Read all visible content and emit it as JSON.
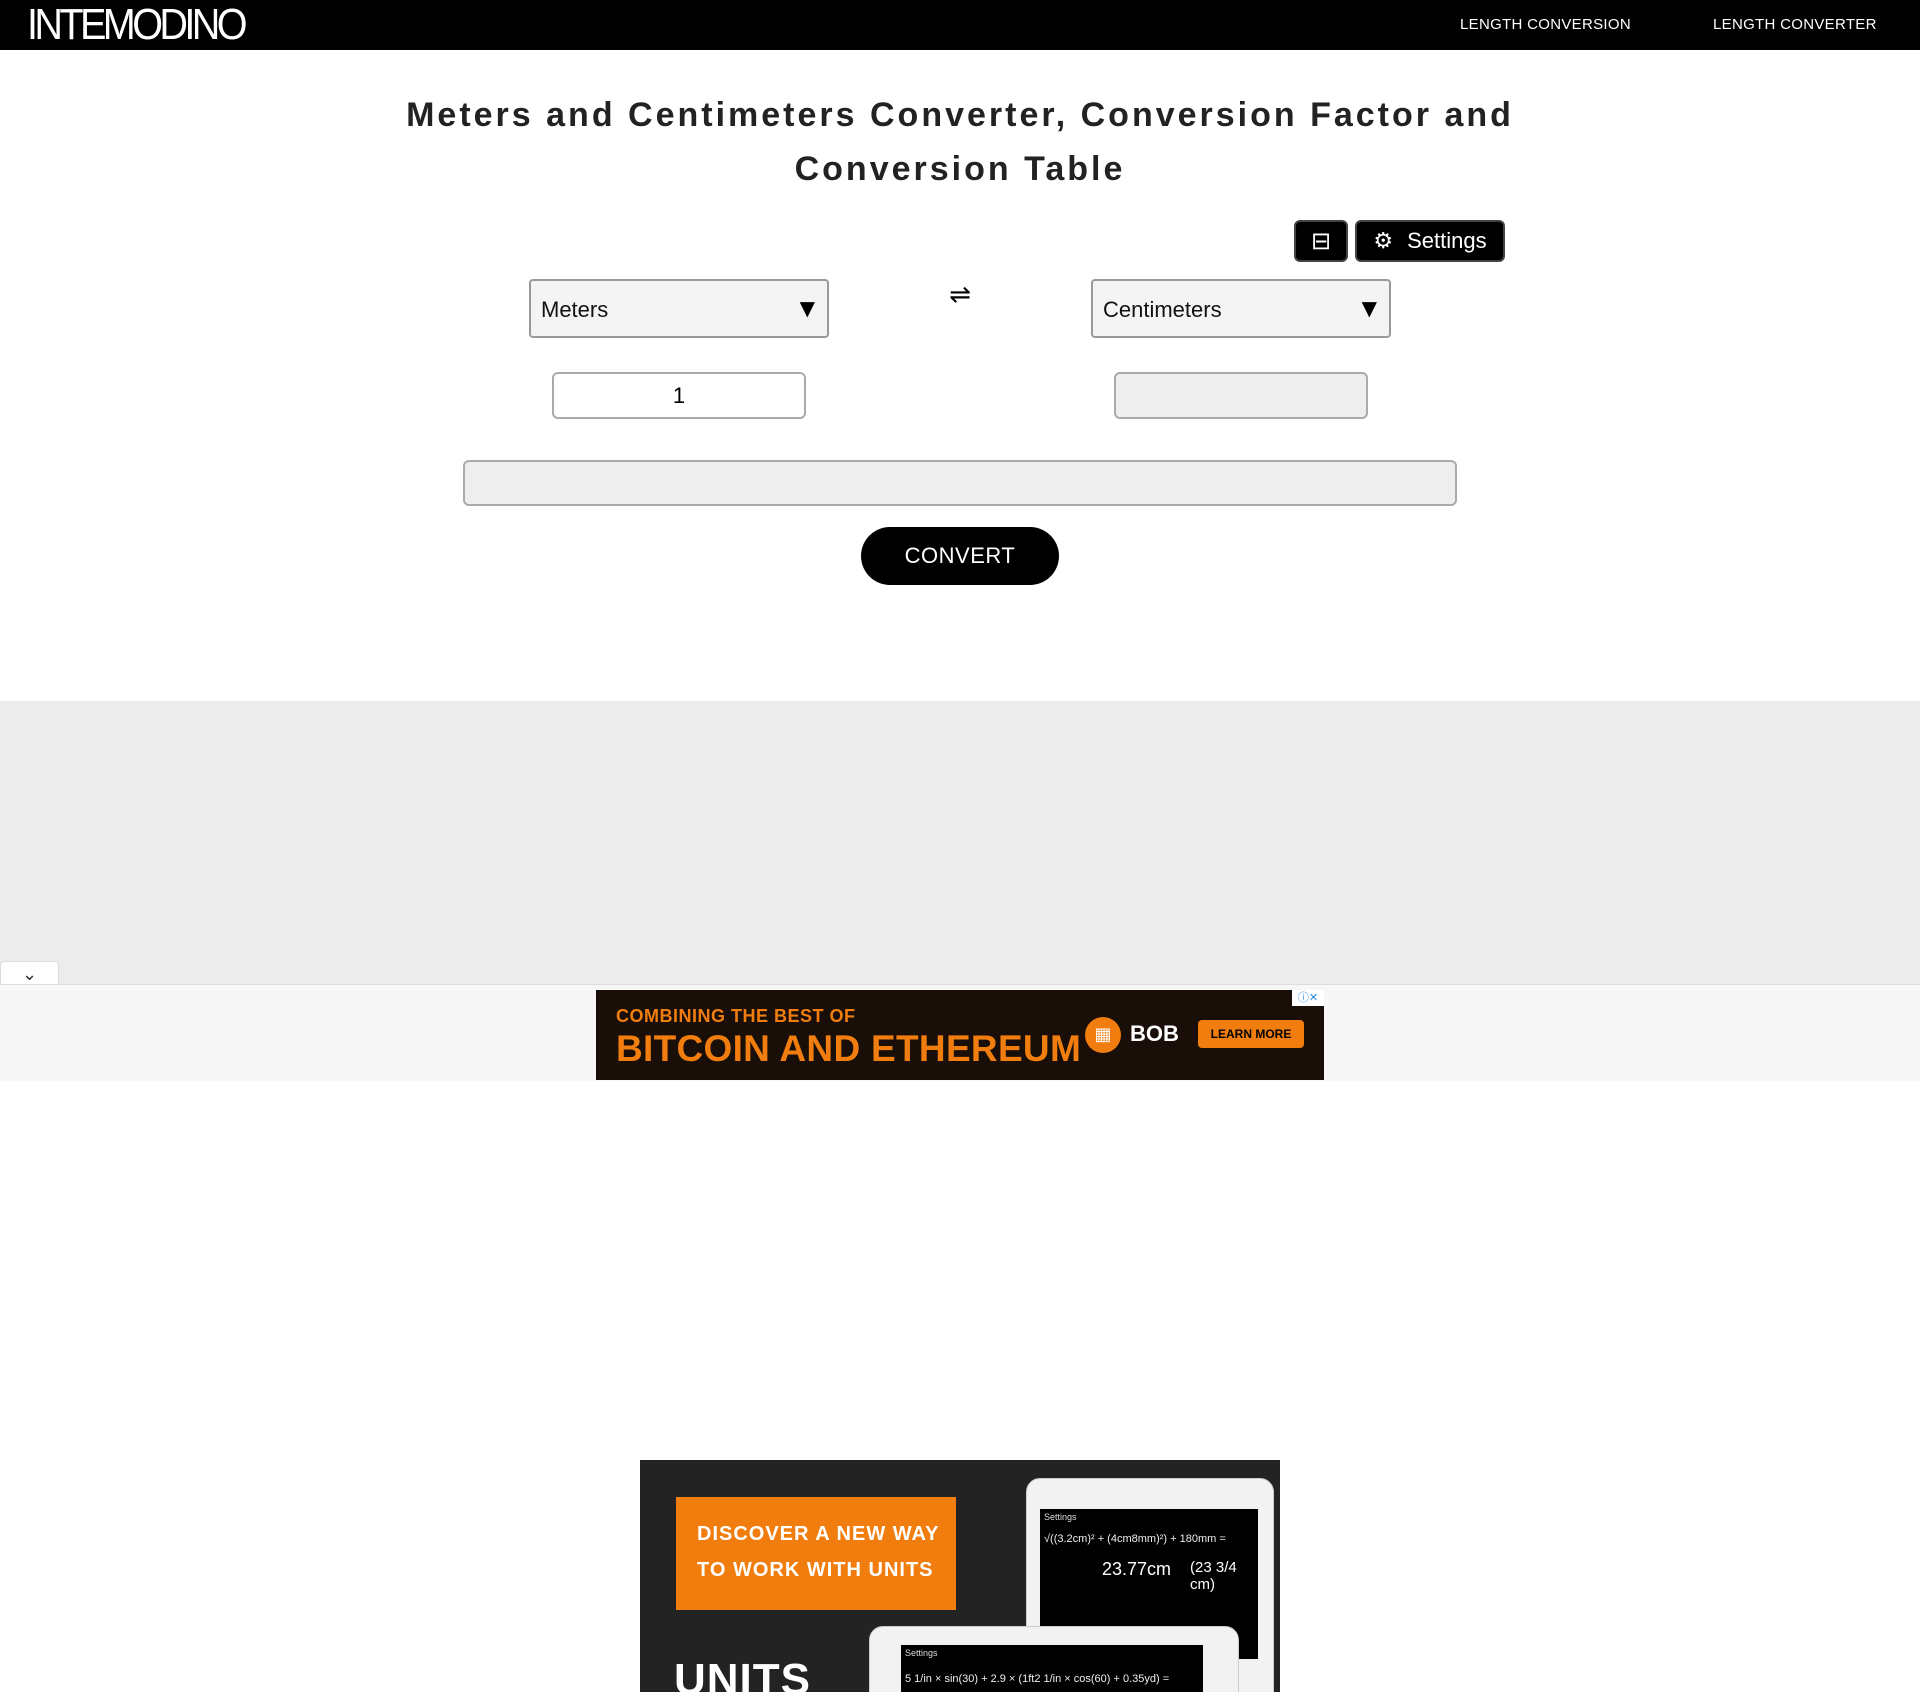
{
  "header": {
    "logo": "INTEMODINO",
    "nav": [
      "LENGTH CONVERSION",
      "LENGTH CONVERTER"
    ]
  },
  "page": {
    "title": "Meters and Centimeters Converter, Conversion Factor and Conversion Table"
  },
  "toolbar": {
    "compact_icon": "compact-view-icon",
    "settings_icon": "gear-icon",
    "settings_label": "Settings"
  },
  "converter": {
    "from_unit": "Meters",
    "to_unit": "Centimeters",
    "swap_icon": "swap-arrows-icon",
    "from_value": "1",
    "to_value": "",
    "formula": "",
    "convert_label": "CONVERT"
  },
  "ad_units": {
    "promo_line1": "DISCOVER A NEW WAY",
    "promo_line2": "TO WORK WITH UNITS",
    "brand": "UNITS",
    "screen1_label": "Settings",
    "screen1_expr": "√((3.2cm)² + (4cm8mm)²) + 180mm =",
    "screen1_result": "23.77cm",
    "screen1_fraction": "(23 3/4 cm)",
    "screen2_label": "Settings",
    "screen2_expr": "5 1/in × sin(30) + 2.9 × (1ft2 1/in × cos(60) + 0.35yd) ="
  },
  "ad_banner": {
    "line1": "COMBINING THE BEST OF",
    "line2": "BITCOIN AND ETHEREUM",
    "brand": "BOB",
    "cta": "LEARN MORE",
    "colors": {
      "accent": "#f07d0d",
      "background": "#1a0f08"
    }
  },
  "colors": {
    "header_bg": "#000000",
    "band_bg": "#ececec",
    "button_bg": "#000000"
  }
}
